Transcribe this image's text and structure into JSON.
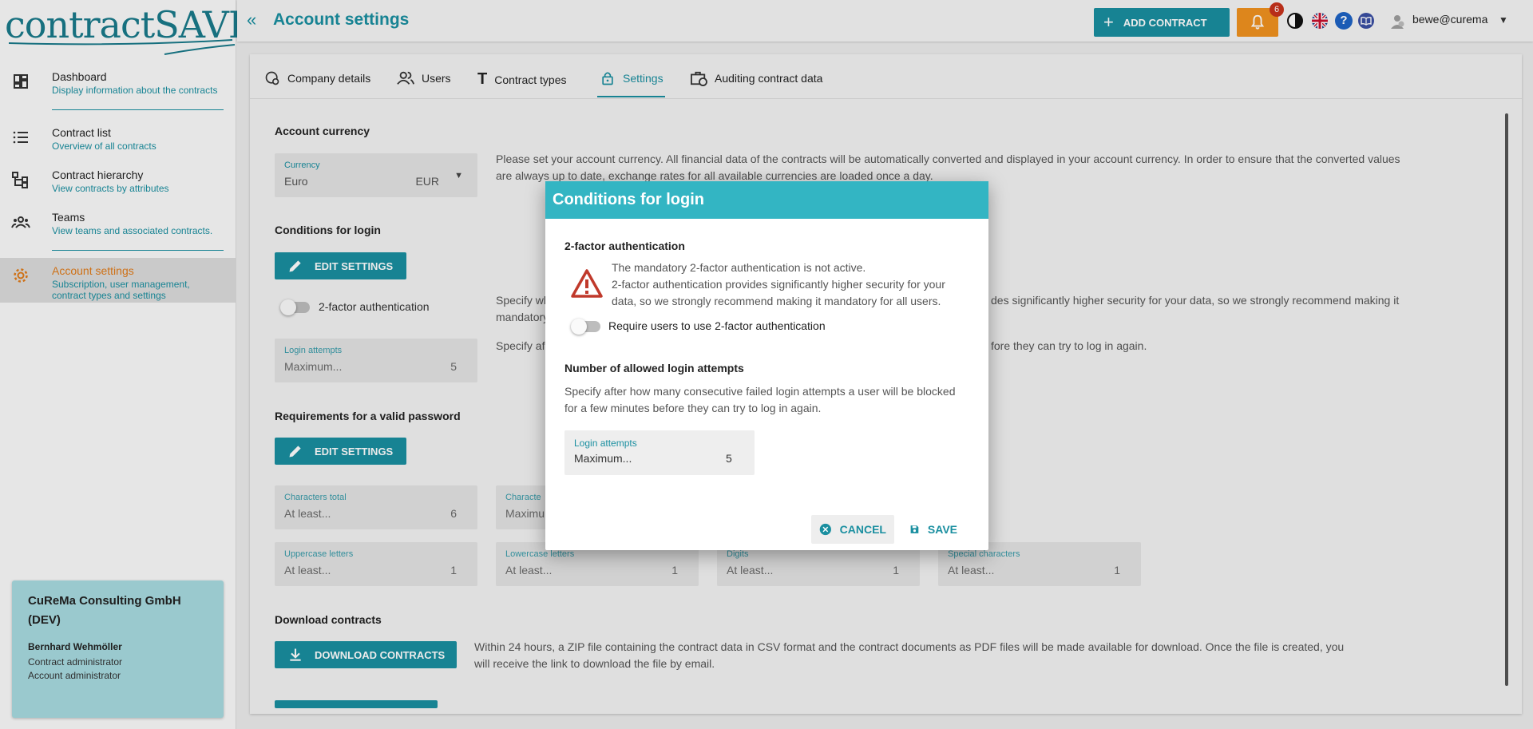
{
  "brand": {
    "logo_text": "contractSAVE"
  },
  "sidebar": {
    "items": [
      {
        "title": "Dashboard",
        "subtitle": "Display information about the contracts"
      },
      {
        "title": "Contract list",
        "subtitle": "Overview of all contracts"
      },
      {
        "title": "Contract hierarchy",
        "subtitle": "View contracts by attributes"
      },
      {
        "title": "Teams",
        "subtitle": "View teams and associated contracts."
      },
      {
        "title": "Account settings",
        "subtitle": "Subscription, user management, contract types and settings"
      }
    ],
    "company": {
      "name": "CuReMa Consulting GmbH (DEV)",
      "user": "Bernhard Wehmöller",
      "roles": [
        "Contract administrator",
        "Account administrator"
      ]
    }
  },
  "header": {
    "title": "Account settings",
    "add_contract": "ADD CONTRACT",
    "notification_count": "6",
    "user": "bewe@curema"
  },
  "tabs": [
    "Company details",
    "Users",
    "Contract types",
    "Settings",
    "Auditing contract data"
  ],
  "settings": {
    "currency": {
      "title": "Account currency",
      "label": "Currency",
      "value": "Euro",
      "code": "EUR",
      "description": "Please set your account currency. All financial data of the contracts will be automatically converted and displayed in your account currency. In order to ensure that the converted values are always up to date, exchange rates for all available currencies are loaded once a day."
    },
    "login": {
      "title": "Conditions for login",
      "edit": "EDIT SETTINGS",
      "twofa_label": "2-factor authentication",
      "twofa_desc_visible_start": "Specify wh",
      "twofa_desc_visible_end": "des significantly higher security for your data, so we strongly recommend making it",
      "twofa_desc_line2": "mandatory",
      "attempts_label": "Login attempts",
      "attempts_value": "Maximum...",
      "attempts_count": "5",
      "attempts_desc_start": "Specify af",
      "attempts_desc_end": "fore they can try to log in again."
    },
    "password": {
      "title": "Requirements for a valid password",
      "edit": "EDIT SETTINGS",
      "fields": [
        {
          "label": "Characters total",
          "value": "At least...",
          "count": "6"
        },
        {
          "label": "Characte",
          "value": "Maximu",
          "count": ""
        },
        {
          "label": "Uppercase letters",
          "value": "At least...",
          "count": "1"
        },
        {
          "label": "Lowercase letters",
          "value": "At least...",
          "count": "1"
        },
        {
          "label": "Digits",
          "value": "At least...",
          "count": "1"
        },
        {
          "label": "Special characters",
          "value": "At least...",
          "count": "1"
        }
      ]
    },
    "download": {
      "title": "Download contracts",
      "button": "DOWNLOAD CONTRACTS",
      "desc": "Within 24 hours, a ZIP file containing the contract data in CSV format and the contract documents as PDF files will be made available for download. Once the file is created, you will receive the link to download the file by email."
    }
  },
  "dialog": {
    "title": "Conditions for login",
    "twofa_title": "2-factor authentication",
    "warning_line1": "The mandatory 2-factor authentication is not active.",
    "warning_line2": "2-factor authentication provides significantly higher security for your data, so we strongly recommend making it mandatory for all users.",
    "toggle_label": "Require users to use 2-factor authentication",
    "attempts_title": "Number of allowed login attempts",
    "attempts_desc": "Specify after how many consecutive failed login attempts a user will be blocked for a few minutes before they can try to log in again.",
    "field_label": "Login attempts",
    "field_value": "Maximum...",
    "field_count": "5",
    "cancel": "CANCEL",
    "save": "SAVE"
  },
  "colors": {
    "accent": "#1a8fa0",
    "dialog_header": "#33b5c3",
    "warning": "#c0392b",
    "notification": "#f0921f"
  }
}
